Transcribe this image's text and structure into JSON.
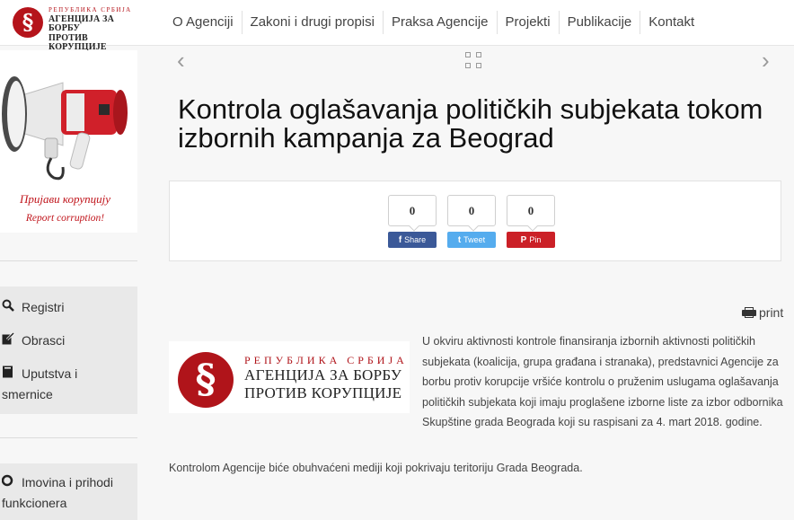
{
  "header": {
    "logo": {
      "emblem": "§",
      "line1": "РЕПУБЛИКА СРБИЈА",
      "line2": "АГЕНЦИЈА ЗА БОРБУ",
      "line3": "ПРОТИВ КОРУПЦИЈЕ"
    },
    "nav": [
      {
        "label": "O Agenciji"
      },
      {
        "label": "Zakoni i drugi propisi"
      },
      {
        "label": "Praksa Agencije"
      },
      {
        "label": "Projekti"
      },
      {
        "label": "Publikacije"
      },
      {
        "label": "Kontakt"
      }
    ]
  },
  "sidebar": {
    "banner": {
      "line1": "Пријави корупцију",
      "line2": "Report corruption!"
    },
    "items": [
      {
        "label": "Registri",
        "icon": "search-icon"
      },
      {
        "label": "Obrasci",
        "icon": "edit-icon"
      },
      {
        "label": "Uputstva i smernice",
        "icon": "book-icon"
      }
    ],
    "item_bottom": {
      "label": "Imovina i prihodi funkcionera",
      "icon": "circle-icon"
    }
  },
  "article": {
    "nav": {
      "prev": "‹",
      "next": "›"
    },
    "title": "Kontrola oglašavanja političkih subjekata tokom izbornih kampanja za Beograd",
    "share": [
      {
        "count": "0",
        "label": "Share",
        "icon": "facebook-icon",
        "glyph": "f",
        "color": "#3b5998"
      },
      {
        "count": "0",
        "label": "Tweet",
        "icon": "twitter-icon",
        "glyph": "t",
        "color": "#55acee"
      },
      {
        "count": "0",
        "label": "Pin",
        "icon": "pinterest-icon",
        "glyph": "P",
        "color": "#cb2027"
      }
    ],
    "print_label": "print",
    "image_logo": {
      "emblem": "§",
      "line1": "РЕПУБЛИКА СРБИЈА",
      "line2": "АГЕНЦИЈА ЗА БОРБУ",
      "line3": "ПРОТИВ КОРУПЦИЈЕ"
    },
    "paragraph1": " U okviru aktivnosti kontrole finansiranja izbornih aktivnosti političkih subjekata (koalicija, grupa građana i stranaka), predstavnici Agencije za borbu protiv korupcije vršiće kontrolu o pruženim uslugama oglašavanja političkih subjekata koji imaju proglašene izborne liste za izbor odbornika Skupštine grada Beograda koji su raspisani za 4. mart 2018. godine.",
    "paragraph2": "Kontrolom Agencije biće obuhvaćeni mediji koji pokrivaju teritoriju Grada Beograda."
  }
}
